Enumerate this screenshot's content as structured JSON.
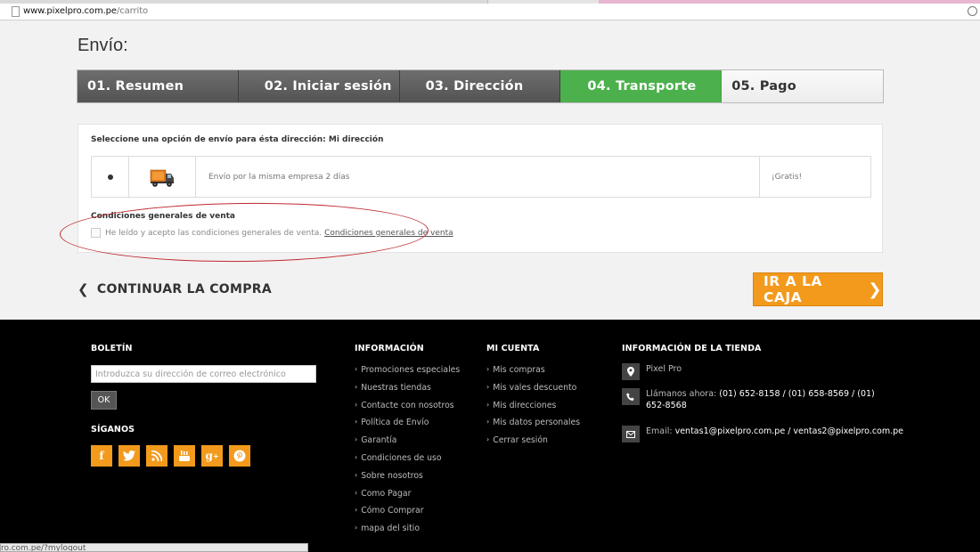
{
  "browser": {
    "url_host": "www.pixelpro.com.pe",
    "url_path": "/carrito",
    "status_url": "ro.com.pe/?mylogout"
  },
  "page": {
    "heading": "Envío:"
  },
  "steps": [
    {
      "label": "01. Resumen",
      "state": "done"
    },
    {
      "label": "02. Iniciar sesión",
      "state": "done"
    },
    {
      "label": "03. Dirección",
      "state": "done"
    },
    {
      "label": "04. Transporte",
      "state": "current"
    },
    {
      "label": "05. Pago",
      "state": "todo"
    }
  ],
  "shipping": {
    "title": "Seleccione una opción de envío para ésta dirección: Mi dirección",
    "option": {
      "description": "Envío por la misma empresa 2 días",
      "price": "¡Gratis!",
      "selected": true,
      "icon": "truck-icon"
    },
    "conditions_title": "Condiciones generales de venta",
    "conditions_text": "He leído y acepto las condiciones generales de venta.",
    "conditions_link": "Condiciones generales de venta",
    "conditions_accepted": false
  },
  "actions": {
    "continue_label": "CONTINUAR LA COMPRA",
    "checkout_label": "IR A LA CAJA"
  },
  "footer": {
    "newsletter": {
      "title": "BOLETÍN",
      "placeholder": "Introduzca su dirección de correo electrónico",
      "button": "OK"
    },
    "social": {
      "title": "SÍGANOS",
      "networks": [
        "facebook-icon",
        "twitter-icon",
        "rss-icon",
        "youtube-icon",
        "google-plus-icon",
        "pinterest-icon"
      ]
    },
    "info": {
      "title": "INFORMACIÓN",
      "links": [
        "Promociones especiales",
        "Nuestras tiendas",
        "Contacte con nosotros",
        "Política de Envío",
        "Garantía",
        "Condiciones de uso",
        "Sobre nosotros",
        "Como Pagar",
        "Cómo Comprar",
        "mapa del sitio"
      ]
    },
    "account": {
      "title": "MI CUENTA",
      "links": [
        "Mis compras",
        "Mis vales descuento",
        "Mis direcciones",
        "Mis datos personales",
        "Cerrar sesión"
      ]
    },
    "store": {
      "title": "INFORMACIÓN DE LA TIENDA",
      "name": "Pixel Pro",
      "phone_label": "Llámanos ahora:",
      "phone_line1": "(01) 652-8158 / (01) 658-8569 / (01)",
      "phone_line2": "652-8568",
      "email_label": "Email:",
      "emails": "ventas1@pixelpro.com.pe / ventas2@pixelpro.com.pe"
    }
  },
  "colors": {
    "accent_orange": "#f39a1d",
    "step_active_green": "#4cb14c",
    "annotation_red": "#c0282d"
  }
}
